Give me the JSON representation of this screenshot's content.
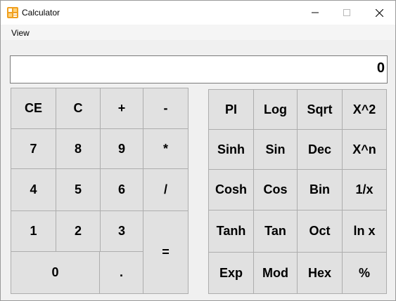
{
  "window": {
    "title": "Calculator"
  },
  "menu": {
    "view": "View"
  },
  "display": {
    "value": "0"
  },
  "left_keys": {
    "ce": "CE",
    "c": "C",
    "plus": "+",
    "minus": "-",
    "n7": "7",
    "n8": "8",
    "n9": "9",
    "multiply": "*",
    "n4": "4",
    "n5": "5",
    "n6": "6",
    "divide": "/",
    "n1": "1",
    "n2": "2",
    "n3": "3",
    "equals": "=",
    "n0": "0",
    "dot": "."
  },
  "right_keys": {
    "pi": "PI",
    "log": "Log",
    "sqrt": "Sqrt",
    "x2": "X^2",
    "sinh": "Sinh",
    "sin": "Sin",
    "dec": "Dec",
    "xn": "X^n",
    "cosh": "Cosh",
    "cos": "Cos",
    "bin": "Bin",
    "inv": "1/x",
    "tanh": "Tanh",
    "tan": "Tan",
    "oct": "Oct",
    "ln": "ln x",
    "exp": "Exp",
    "mod": "Mod",
    "hex": "Hex",
    "pct": "%"
  },
  "colors": {
    "accent": "#f0a020",
    "button_face": "#e1e1e1",
    "button_border": "#adadad"
  },
  "icons": {
    "app": "calculator-app-icon",
    "minimize": "minimize-icon",
    "maximize": "maximize-icon",
    "close": "close-icon"
  }
}
